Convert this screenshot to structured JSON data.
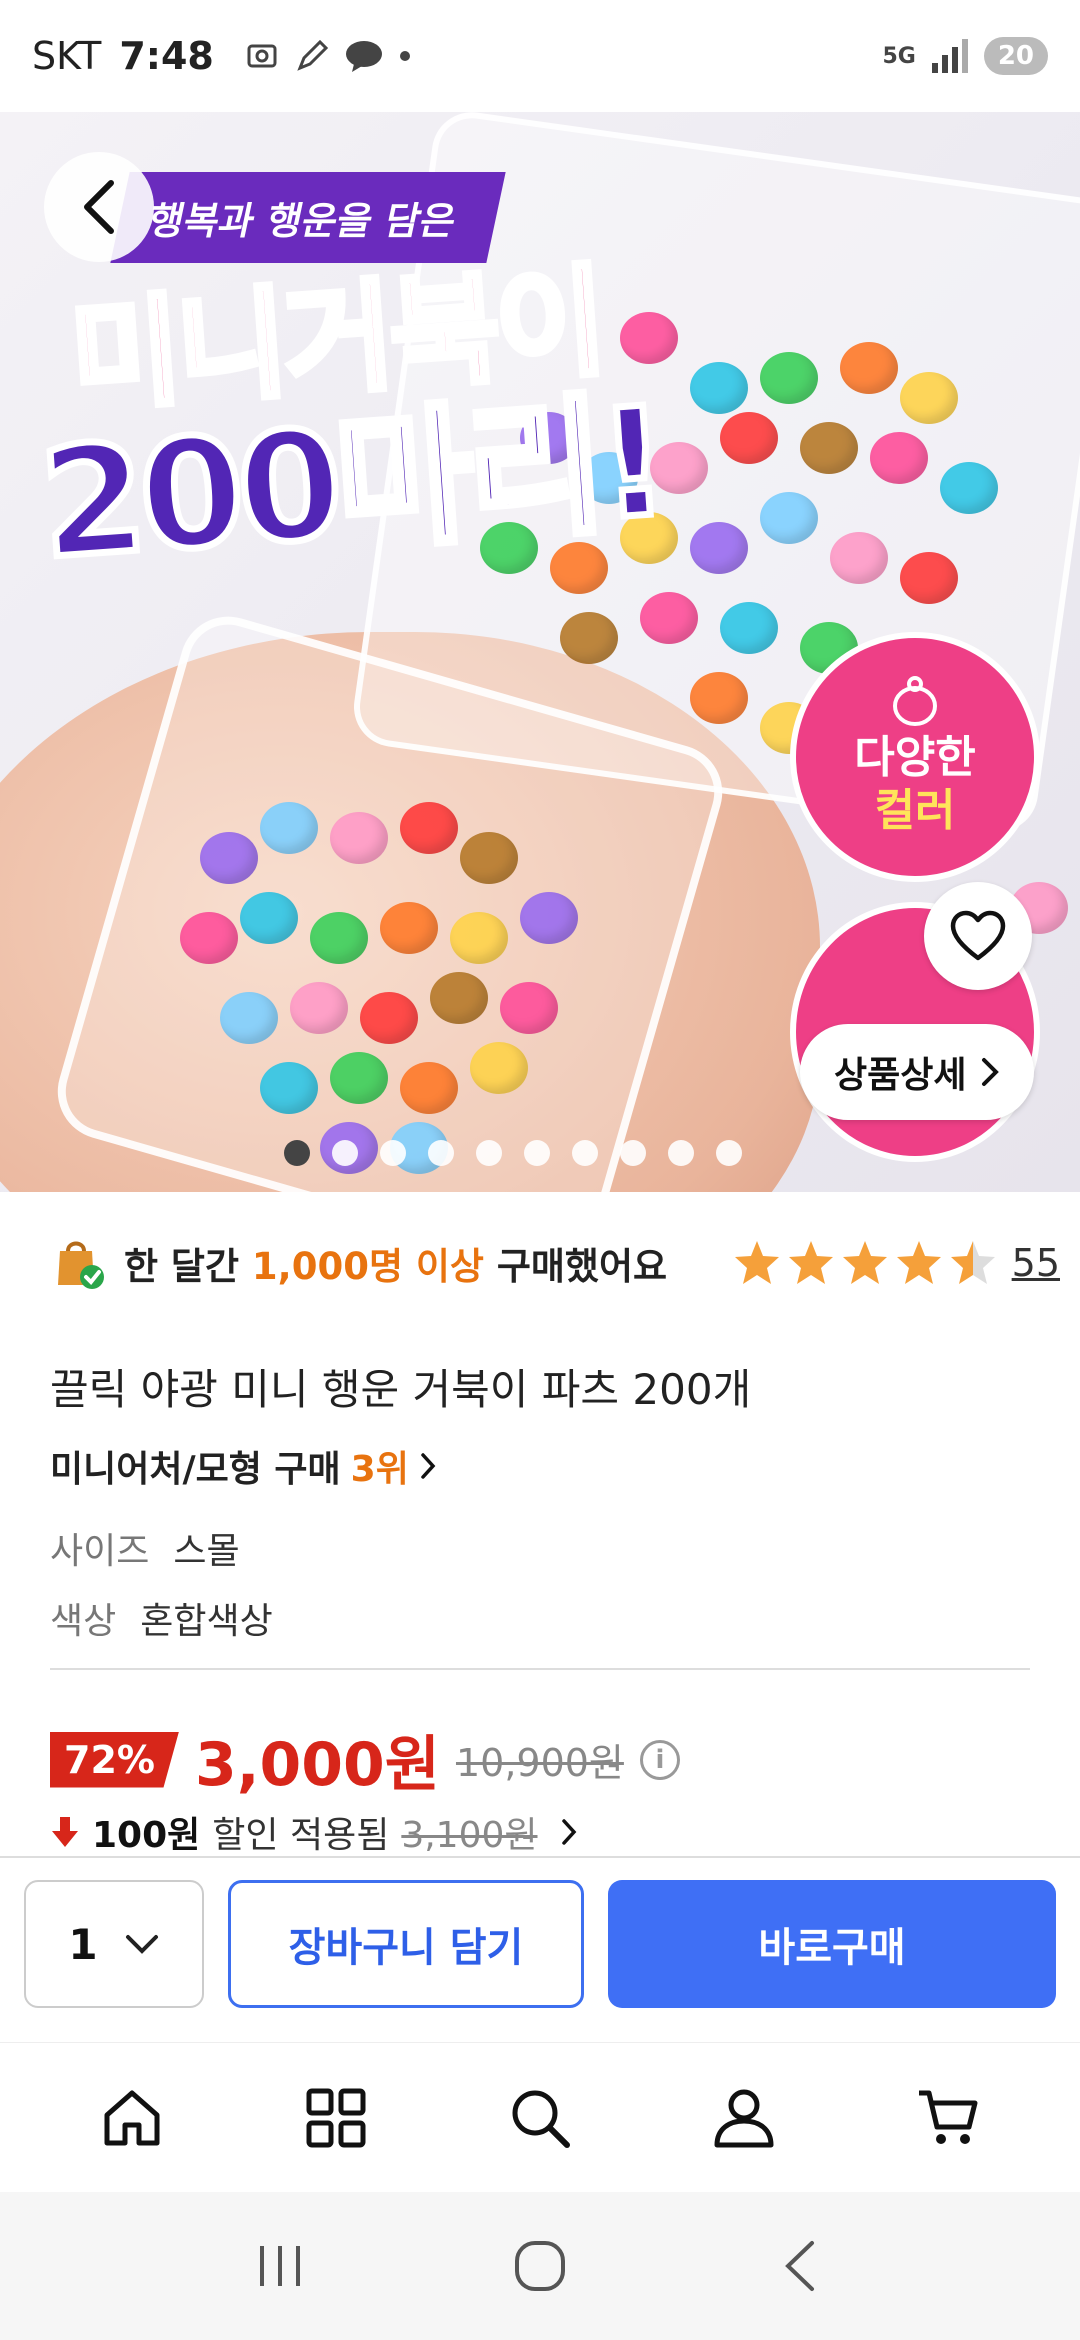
{
  "status_bar": {
    "carrier": "SKT",
    "time": "7:48",
    "network": "5G",
    "battery": "20"
  },
  "hero": {
    "ribbon": "행복과 행운을 담은",
    "headline_line1": "미니거북이",
    "headline_line2": "200마리!",
    "badge_line1": "다양한",
    "badge_line2": "컬러",
    "detail_button": "상품상세",
    "slide_count": 10,
    "active_slide": 0
  },
  "buy_stats": {
    "prefix": "한 달간",
    "highlight": "1,000명 이상",
    "suffix": "구매했어요",
    "rating": 4.5,
    "review_count": "55"
  },
  "product": {
    "title": "끌릭 야광 미니 행운 거북이 파츠 200개",
    "rank_category": "미니어처/모형 구매",
    "rank_value": "3위",
    "options": [
      {
        "label": "사이즈",
        "value": "스몰"
      },
      {
        "label": "색상",
        "value": "혼합색상"
      }
    ]
  },
  "price": {
    "discount": "72%",
    "current": "3,000원",
    "original": "10,900원",
    "coupon_amount": "100원",
    "coupon_text": "할인 적용됨",
    "coupon_original": "3,100원"
  },
  "purchase_bar": {
    "quantity": "1",
    "cart_label": "장바구니 담기",
    "buy_label": "바로구매"
  },
  "colors": {
    "accent_blue": "#3f6ff5",
    "price_red": "#d7261a",
    "highlight_orange": "#e8730f",
    "star_orange": "#f5a03a"
  },
  "bottom_nav": [
    "home-icon",
    "category-grid-icon",
    "search-icon",
    "profile-icon",
    "cart-icon"
  ]
}
